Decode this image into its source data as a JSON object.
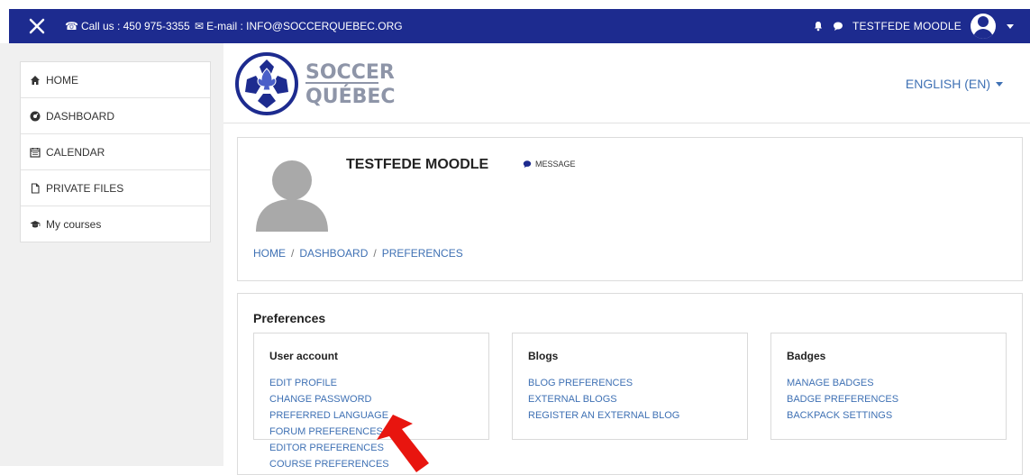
{
  "topbar": {
    "contact_text": "Call us : 450 975-3355",
    "email_text": "E-mail : INFO@SOCCERQUEBEC.ORG",
    "username": "TESTFEDE MOODLE",
    "bg_color": "#1d2b8f"
  },
  "sidebar": {
    "items": [
      {
        "label": "HOME",
        "icon": "home-icon"
      },
      {
        "label": "DASHBOARD",
        "icon": "dashboard-icon"
      },
      {
        "label": "CALENDAR",
        "icon": "calendar-icon"
      },
      {
        "label": "PRIVATE FILES",
        "icon": "file-icon"
      },
      {
        "label": "My courses",
        "icon": "graduation-cap-icon"
      }
    ]
  },
  "brand": {
    "logo_line1": "SOCCER",
    "logo_line2": "QUÉBEC",
    "language": "ENGLISH (EN)"
  },
  "profile": {
    "name": "TESTFEDE MOODLE",
    "message_label": "MESSAGE",
    "breadcrumb": [
      "HOME",
      "DASHBOARD",
      "PREFERENCES"
    ]
  },
  "preferences": {
    "title": "Preferences",
    "sections": [
      {
        "heading": "User account",
        "links": [
          "EDIT PROFILE",
          "CHANGE PASSWORD",
          "PREFERRED LANGUAGE",
          "FORUM PREFERENCES",
          "EDITOR PREFERENCES",
          "COURSE PREFERENCES"
        ]
      },
      {
        "heading": "Blogs",
        "links": [
          "BLOG PREFERENCES",
          "EXTERNAL BLOGS",
          "REGISTER AN EXTERNAL BLOG"
        ]
      },
      {
        "heading": "Badges",
        "links": [
          "MANAGE BADGES",
          "BADGE PREFERENCES",
          "BACKPACK SETTINGS"
        ]
      }
    ]
  },
  "colors": {
    "link": "#3f71b4",
    "arrow": "#e8150f"
  }
}
